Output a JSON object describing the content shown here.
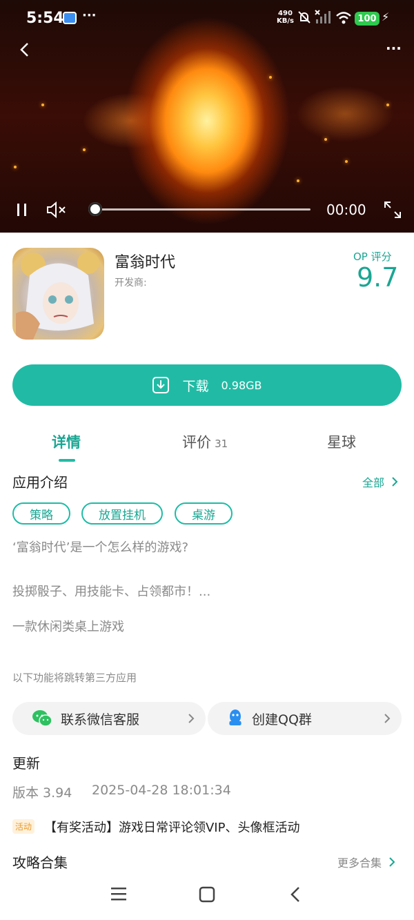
{
  "status_bar": {
    "time": "5:54",
    "net_speed_value": "490",
    "net_speed_unit": "KB/s",
    "battery": "100"
  },
  "video": {
    "time": "00:00",
    "progress": 0.0
  },
  "app": {
    "name": "富翁时代",
    "developer_label": "开发商:",
    "score_label": "OP 评分",
    "score": "9.7"
  },
  "download": {
    "label": "下载",
    "size": "0.98GB"
  },
  "tabs": [
    {
      "label": "详情",
      "active": true
    },
    {
      "label": "评价",
      "count": "31"
    },
    {
      "label": "星球"
    }
  ],
  "intro": {
    "title": "应用介绍",
    "all_label": "全部",
    "tags": [
      "策略",
      "放置挂机",
      "桌游"
    ],
    "lines": [
      "‘富翁时代’是一个怎么样的游戏?",
      "投掷骰子、用技能卡、占领都市！...",
      "一款休闲类桌上游戏"
    ]
  },
  "third_party": {
    "note": "以下功能将跳转第三方应用",
    "wechat_label": "联系微信客服",
    "qq_label": "创建QQ群"
  },
  "update": {
    "title": "更新",
    "version": "版本 3.94",
    "datetime": "2025-04-28 18:01:34"
  },
  "activity": {
    "badge": "活动",
    "text": "【有奖活动】游戏日常评论领VIP、头像框活动"
  },
  "guides": {
    "title": "攻略合集",
    "more_label": "更多合集"
  },
  "colors": {
    "accent": "#21bba5",
    "accent_text": "#1aa693"
  }
}
